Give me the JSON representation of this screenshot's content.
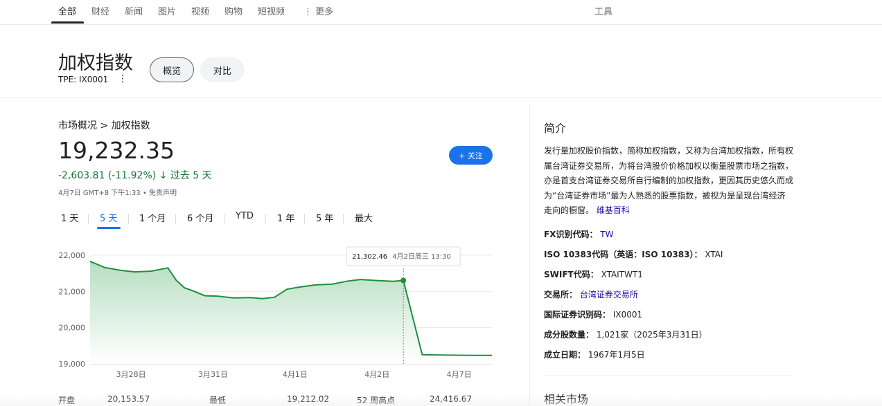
{
  "nav": {
    "tabs": [
      {
        "label": "全部",
        "active": true
      },
      {
        "label": "财经"
      },
      {
        "label": "新闻"
      },
      {
        "label": "图片"
      },
      {
        "label": "视频"
      },
      {
        "label": "购物"
      },
      {
        "label": "短视频"
      },
      {
        "label": "⋮ 更多"
      }
    ],
    "tools": "工具"
  },
  "header": {
    "title": "加权指数",
    "ticker": "TPE: IX0001",
    "overview_label": "概览",
    "compare_label": "对比"
  },
  "quote": {
    "breadcrumb": "市场概况 > 加权指数",
    "price": "19,232.35",
    "change": "-2,603.81 (-11.92%) ↓ 过去 5 天",
    "timestamp": "4月7日 GMT+8 下午1:33 • 免责声明",
    "follow_label": "+ 关注"
  },
  "ranges": [
    "1 天",
    "5 天",
    "1 个月",
    "6 个月",
    "YTD",
    "1 年",
    "5 年",
    "最大"
  ],
  "active_range": "5 天",
  "chart_data": {
    "type": "area",
    "y_ticks": [
      "22,000",
      "21,000",
      "20,000",
      "19,000"
    ],
    "y_tick_values": [
      22000,
      21000,
      20000,
      19000
    ],
    "ylim": [
      19000,
      22300
    ],
    "x_tick_labels": [
      "3月28日",
      "3月31日",
      "4月1日",
      "4月2日",
      "4月7日"
    ],
    "x_tick_positions": [
      1,
      2,
      3,
      4,
      5
    ],
    "series": [
      {
        "x": [
          0.5,
          0.68,
          0.88,
          1.05,
          1.25,
          1.45,
          1.55,
          1.65,
          1.75,
          1.9,
          2.05,
          2.25,
          2.45,
          2.6,
          2.75,
          2.9,
          3.05,
          3.25,
          3.45,
          3.65,
          3.8,
          4.0,
          4.2,
          4.32,
          4.55,
          4.85,
          5.15,
          5.4
        ],
        "y": [
          21830,
          21660,
          21580,
          21540,
          21560,
          21650,
          21310,
          21100,
          21020,
          20880,
          20870,
          20820,
          20830,
          20800,
          20840,
          21060,
          21120,
          21180,
          21200,
          21290,
          21330,
          21300,
          21280,
          21302.46,
          19250,
          19240,
          19235,
          19232.35
        ]
      }
    ],
    "colors": {
      "line": "#1e8e3e",
      "fill_top": "#b7dfc1",
      "fill_bottom": "#ffffff"
    },
    "tooltip": {
      "value": "21,302.46",
      "date": "4月2日周三 13:30",
      "x": 4.32,
      "y": 21302.46
    }
  },
  "stats": [
    {
      "label": "开盘",
      "value": "20,153.57"
    },
    {
      "label": "最低",
      "value": "19,212.02"
    },
    {
      "label": "52 周高点",
      "value": "24,416.67"
    }
  ],
  "about": {
    "title": "简介",
    "text": "发行量加权股价指数，简称加权指数，又称为台湾加权指数，所有权属台湾证券交易所，为将台湾股价价格加权以衡量股票市场之指数，亦是首支台湾证券交易所自行编制的加权指数，更因其历史悠久而成为“台湾证券市场”最为人熟悉的股票指数，被视为是呈现台湾经济走向的橱窗。",
    "wiki_label": "维基百科",
    "facts": [
      {
        "key": "FX识别代码：",
        "value": "TW",
        "link": true
      },
      {
        "key": "ISO 10383代码（英语：ISO 10383）：",
        "value": "XTAI",
        "link": false
      },
      {
        "key": "SWIFT代码：",
        "value": "XTAITWT1",
        "link": false
      },
      {
        "key": "交易所：",
        "value": "台湾证券交易所",
        "link": true
      },
      {
        "key": "国际证券识别码：",
        "value": "IX0001",
        "link": false
      },
      {
        "key": "成分股数量：",
        "value": "1,021家（2025年3月31日）",
        "link": false
      },
      {
        "key": "成立日期：",
        "value": "1967年1月5日",
        "link": false
      }
    ],
    "related_title": "相关市场"
  }
}
